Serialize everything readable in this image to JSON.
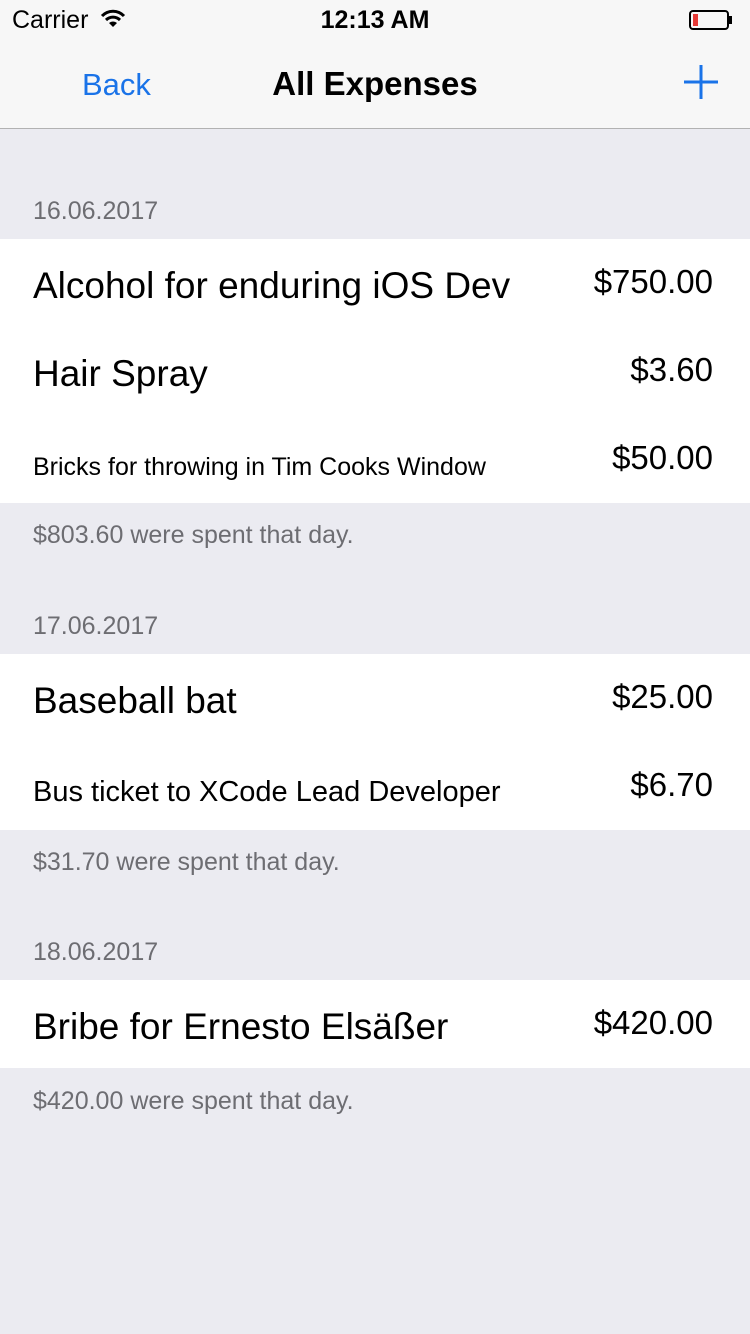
{
  "status_bar": {
    "carrier": "Carrier",
    "time": "12:13 AM",
    "wifi_icon": "wifi-icon",
    "battery_icon": "battery-low-icon"
  },
  "nav": {
    "back_label": "Back",
    "title": "All Expenses",
    "add_icon": "plus-icon"
  },
  "colors": {
    "accent": "#1a73e8",
    "background": "#ebebf1",
    "secondary_text": "#6d6d72",
    "battery_low": "#e53935"
  },
  "sections": [
    {
      "date": "16.06.2017",
      "items": [
        {
          "name": "Alcohol for enduring iOS Dev",
          "price": "$750.00"
        },
        {
          "name": "Hair Spray",
          "price": "$3.60"
        },
        {
          "name": "Bricks for throwing in Tim Cooks Window",
          "price": "$50.00"
        }
      ],
      "footer": "$803.60 were spent that day."
    },
    {
      "date": "17.06.2017",
      "items": [
        {
          "name": "Baseball bat",
          "price": "$25.00"
        },
        {
          "name": "Bus ticket to XCode Lead Developer",
          "price": "$6.70"
        }
      ],
      "footer": "$31.70 were spent that day."
    },
    {
      "date": "18.06.2017",
      "items": [
        {
          "name": "Bribe for Ernesto Elsäßer",
          "price": "$420.00"
        }
      ],
      "footer": "$420.00 were spent that day."
    }
  ]
}
